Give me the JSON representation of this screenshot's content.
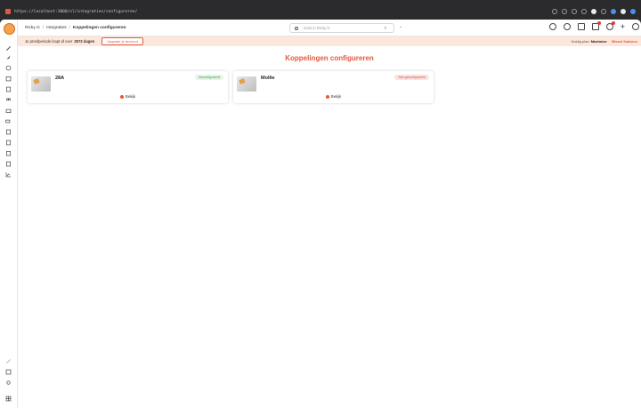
{
  "browser": {
    "url": "https://localhost:3000/nl/integraties/configureren/"
  },
  "topbar": {
    "breadcrumb": [
      "Ricky G",
      "Integraties",
      "Koppelingen configureren"
    ],
    "breadcrumb_sep": "/",
    "search_placeholder": "Zoek in Ricky G"
  },
  "banner": {
    "prefix": "Je proefperiode loopt af over",
    "days": "2573 dagen",
    "upgrade_label": "Upgrade je account",
    "plan_label": "Huidig plan:",
    "plan_name": "Maximize",
    "switch_label": "Wissel features"
  },
  "page": {
    "title": "Koppelingen configureren"
  },
  "cards": [
    {
      "name": "28A",
      "status": "Geconfigureerd",
      "view_label": "Bekijk"
    },
    {
      "name": "Mollie",
      "status": "Niet geconfigureerd",
      "view_label": "Bekijk"
    }
  ],
  "colors": {
    "accent": "#e2583e",
    "banner_bg": "#fde7da",
    "ok": "#3a9a4a",
    "not_ok": "#d9534f"
  }
}
